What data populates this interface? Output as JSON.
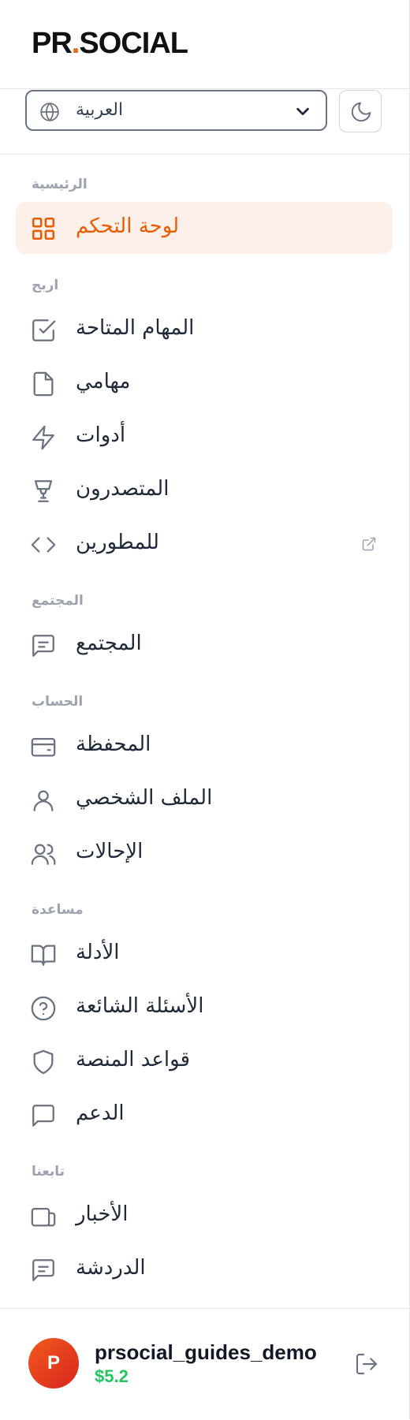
{
  "brand": {
    "logo_left": "PR",
    "logo_dot": ".",
    "logo_right": "SOCIAL",
    "accent": "#f0620a"
  },
  "language": {
    "selected": "العربية",
    "icon": "globe-icon"
  },
  "theme": {
    "icon": "moon-icon"
  },
  "nav": {
    "sections": [
      {
        "label": "الرئيسية",
        "items": [
          {
            "label": "لوحة التحكم",
            "icon": "dashboard-grid-icon",
            "active": true
          }
        ]
      },
      {
        "label": "اربح",
        "items": [
          {
            "label": "المهام المتاحة",
            "icon": "checkbox-icon"
          },
          {
            "label": "مهامي",
            "icon": "file-icon"
          },
          {
            "label": "أدوات",
            "icon": "lightning-icon"
          },
          {
            "label": "المتصدرون",
            "icon": "trophy-icon"
          },
          {
            "label": "للمطورين",
            "icon": "code-icon",
            "external": true
          }
        ]
      },
      {
        "label": "المجتمع",
        "items": [
          {
            "label": "المجتمع",
            "icon": "message-square-icon"
          }
        ]
      },
      {
        "label": "الحساب",
        "items": [
          {
            "label": "المحفظة",
            "icon": "wallet-icon"
          },
          {
            "label": "الملف الشخصي",
            "icon": "user-icon"
          },
          {
            "label": "الإحالات",
            "icon": "users-icon"
          }
        ]
      },
      {
        "label": "مساعدة",
        "items": [
          {
            "label": "الأدلة",
            "icon": "book-icon"
          },
          {
            "label": "الأسئلة الشائعة",
            "icon": "help-circle-icon"
          },
          {
            "label": "قواعد المنصة",
            "icon": "shield-icon"
          },
          {
            "label": "الدعم",
            "icon": "chat-icon"
          }
        ]
      },
      {
        "label": "تابعنا",
        "items": [
          {
            "label": "الأخبار",
            "icon": "news-icon"
          },
          {
            "label": "الدردشة",
            "icon": "message-square-icon"
          }
        ]
      }
    ]
  },
  "user": {
    "avatar_letter": "P",
    "name": "prsocial_guides_demo",
    "balance": "$5.2",
    "balance_color": "#22c55e"
  }
}
